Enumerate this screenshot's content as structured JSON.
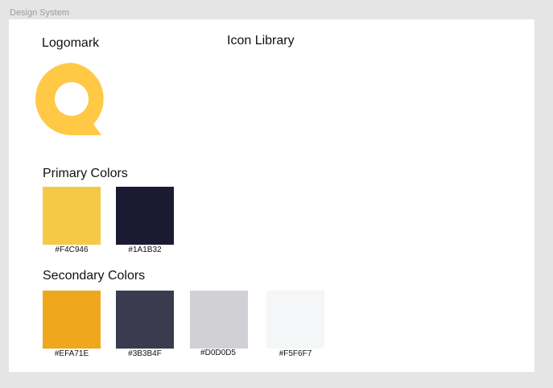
{
  "frame": {
    "label": "Design System"
  },
  "logomark": {
    "title": "Logomark",
    "icon": "speech-bubble-logo-icon",
    "color": "#FFC946"
  },
  "icon_library": {
    "title": "Icon Library"
  },
  "primary": {
    "title": "Primary Colors",
    "swatches": [
      {
        "hex": "#F4C946",
        "label": "#F4C946"
      },
      {
        "hex": "#1A1B32",
        "label": "#1A1B32"
      }
    ]
  },
  "secondary": {
    "title": "Secondary Colors",
    "swatches": [
      {
        "hex": "#EFA71E",
        "label": "#EFA71E"
      },
      {
        "hex": "#3B3B4F",
        "label": "#3B3B4F"
      },
      {
        "hex": "#D0D0D5",
        "label": "#D0D0D5"
      },
      {
        "hex": "#F5F6F7",
        "label": "#F5F6F7"
      }
    ]
  }
}
